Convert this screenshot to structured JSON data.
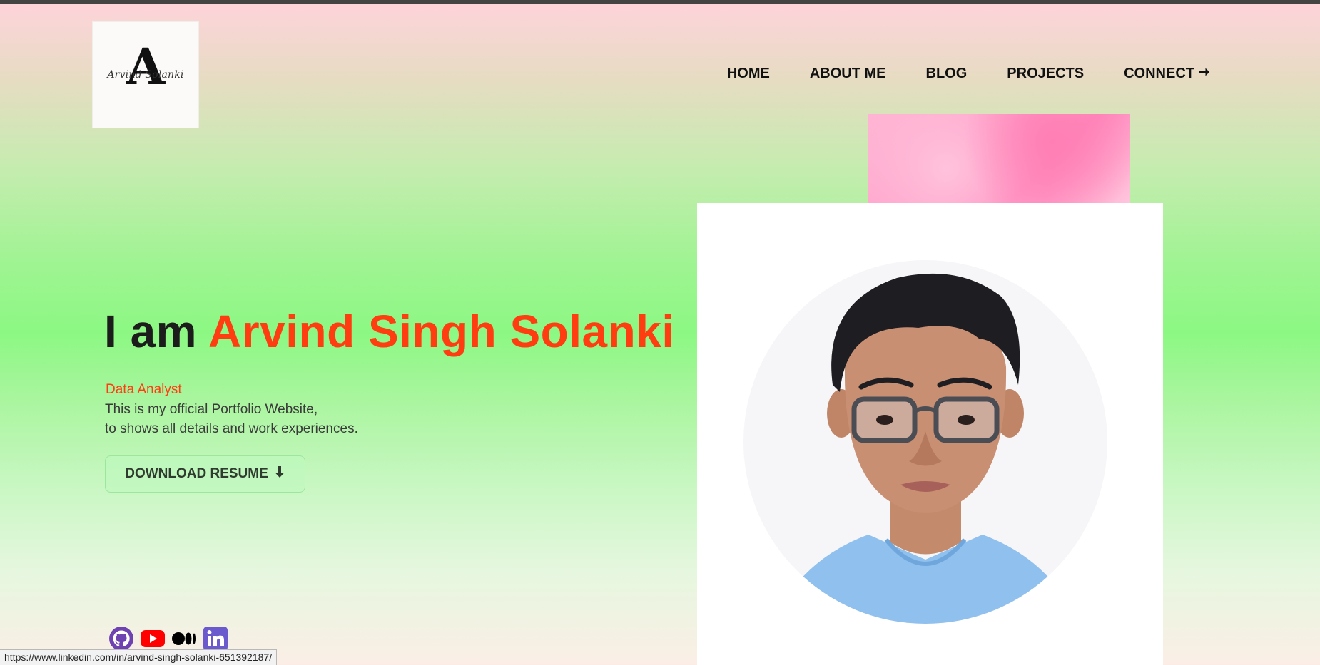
{
  "logo": {
    "letter": "A",
    "name": "Arvind Solanki"
  },
  "nav": {
    "items": [
      {
        "label": "HOME"
      },
      {
        "label": "ABOUT ME"
      },
      {
        "label": "BLOG"
      },
      {
        "label": "PROJECTS"
      },
      {
        "label": "CONNECT",
        "icon": "arrow-right-icon"
      }
    ]
  },
  "hero": {
    "prefix": "I am",
    "name": "Arvind Singh Solanki",
    "role": "Data Analyst",
    "desc_line1": "This is my official Portfolio Website,",
    "desc_line2": "to shows all details and work experiences.",
    "button_label": "DOWNLOAD RESUME",
    "button_icon": "arrow-down-icon"
  },
  "socials": [
    {
      "icon": "github-icon",
      "color": "#6e42b0"
    },
    {
      "icon": "youtube-icon",
      "color": "#ff0000"
    },
    {
      "icon": "medium-icon",
      "color": "#000000"
    },
    {
      "icon": "linkedin-icon",
      "color": "#6a5acd"
    }
  ],
  "status_url": "https://www.linkedin.com/in/arvind-singh-solanki-651392187/",
  "colors": {
    "accent": "#ff3d10",
    "button_border": "#9ce79c",
    "pink": "#ff86bb"
  }
}
